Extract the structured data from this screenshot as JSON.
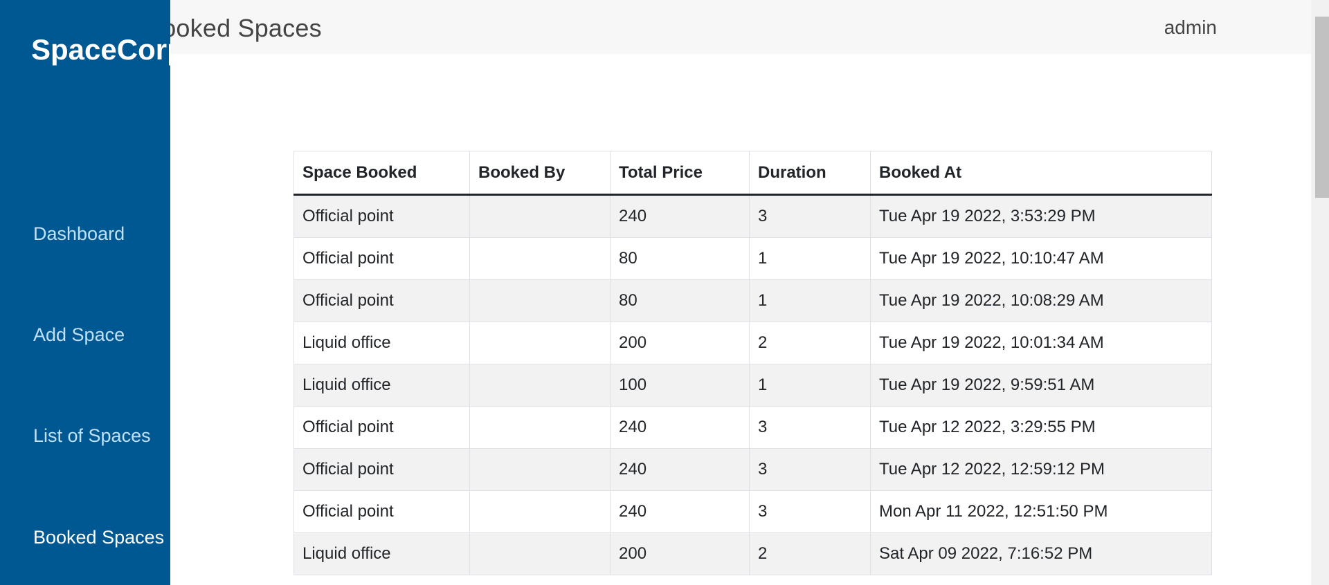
{
  "brand": "SpaceCorp",
  "header": {
    "title": "Booked Spaces",
    "user": "admin"
  },
  "sidebar": {
    "items": [
      {
        "label": "Dashboard"
      },
      {
        "label": "Add Space"
      },
      {
        "label": "List of Spaces"
      },
      {
        "label": "Booked Spaces"
      }
    ]
  },
  "table": {
    "columns": [
      "Space Booked",
      "Booked By",
      "Total Price",
      "Duration",
      "Booked At"
    ],
    "rows": [
      [
        "Official point",
        "",
        "240",
        "3",
        "Tue Apr 19 2022, 3:53:29 PM"
      ],
      [
        "Official point",
        "",
        "80",
        "1",
        "Tue Apr 19 2022, 10:10:47 AM"
      ],
      [
        "Official point",
        "",
        "80",
        "1",
        "Tue Apr 19 2022, 10:08:29 AM"
      ],
      [
        "Liquid office",
        "",
        "200",
        "2",
        "Tue Apr 19 2022, 10:01:34 AM"
      ],
      [
        "Liquid office",
        "",
        "100",
        "1",
        "Tue Apr 19 2022, 9:59:51 AM"
      ],
      [
        "Official point",
        "",
        "240",
        "3",
        "Tue Apr 12 2022, 3:29:55 PM"
      ],
      [
        "Official point",
        "",
        "240",
        "3",
        "Tue Apr 12 2022, 12:59:12 PM"
      ],
      [
        "Official point",
        "",
        "240",
        "3",
        "Mon Apr 11 2022, 12:51:50 PM"
      ],
      [
        "Liquid office",
        "",
        "200",
        "2",
        "Sat Apr 09 2022, 7:16:52 PM"
      ]
    ]
  },
  "colors": {
    "sidebar": "#005893",
    "nav_text": "#bfe0f5",
    "header_bg": "#f7f7f7"
  }
}
